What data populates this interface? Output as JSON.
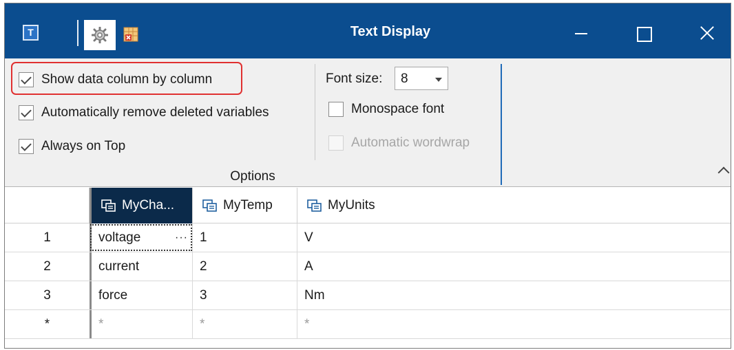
{
  "window": {
    "title": "Text Display",
    "app_icon_letter": "T"
  },
  "ribbon": {
    "options": {
      "show_by_column_label": "Show data column by column",
      "show_by_column_checked": true,
      "auto_remove_label": "Automatically remove deleted variables",
      "auto_remove_checked": true,
      "always_on_top_label": "Always on Top",
      "always_on_top_checked": true,
      "font_size_label": "Font size:",
      "font_size_value": "8",
      "monospace_label": "Monospace font",
      "monospace_checked": false,
      "wordwrap_label": "Automatic wordwrap",
      "wordwrap_enabled": false,
      "group_label": "Options"
    }
  },
  "grid": {
    "columns": [
      {
        "label": "MyCha..."
      },
      {
        "label": "MyTemp"
      },
      {
        "label": "MyUnits"
      }
    ],
    "rows": [
      {
        "header": "1",
        "cells": [
          "voltage",
          "1",
          "V"
        ]
      },
      {
        "header": "2",
        "cells": [
          "current",
          "2",
          "A"
        ]
      },
      {
        "header": "3",
        "cells": [
          "force",
          "3",
          "Nm"
        ]
      }
    ],
    "new_row": {
      "header": "*",
      "cells": [
        "*",
        "*",
        "*"
      ]
    },
    "active_cell_ellipsis": "···"
  },
  "colors": {
    "titlebar": "#0b4d8f",
    "selected_column_header": "#0b2a4a",
    "highlight_border": "#e03030"
  }
}
